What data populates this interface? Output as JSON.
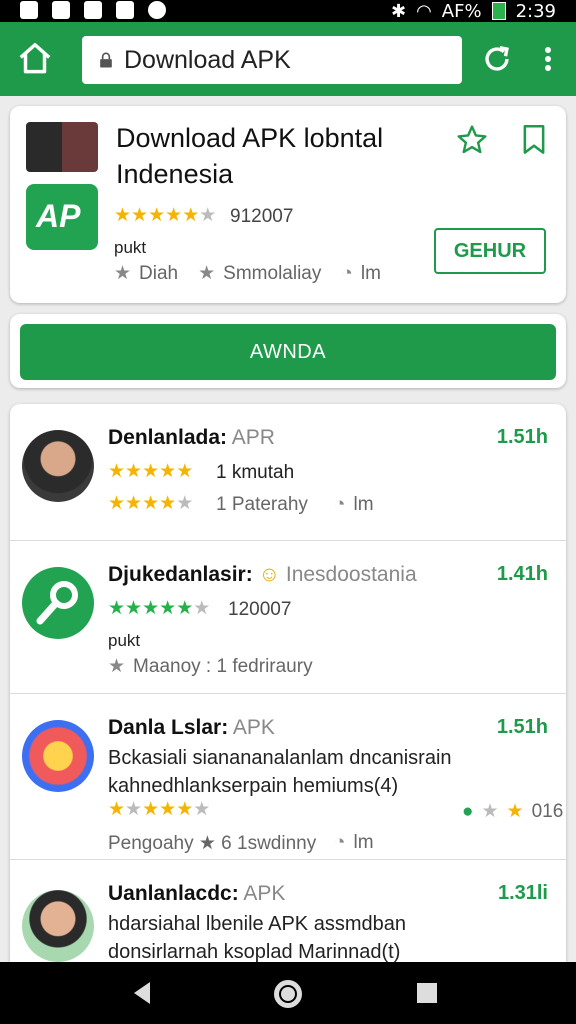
{
  "status": {
    "carrier": "AF%",
    "time": "2:39"
  },
  "browser": {
    "url_title": "Download APK"
  },
  "hero": {
    "title_line1": "Download APK lobntal",
    "title_line2": "Indenesia",
    "rating": 4.5,
    "rating_count": "912007",
    "tag": "pukt",
    "meta1": "Diah",
    "meta2": "Smmolaliay",
    "meta3": "lm",
    "get_label": "GEHUR",
    "logo_text": "AP"
  },
  "download": {
    "label": "AWNDA"
  },
  "list": [
    {
      "title": "Denlanlada:",
      "sub": "APR",
      "size": "1.51h",
      "stars_text": "1 kmutah",
      "meta_text": "1  Paterahy",
      "meta_icon_text": "lm"
    },
    {
      "title": "Djukedanlasir:",
      "sub": "Inesdoostania",
      "size": "1.41h",
      "stars_text": "120007",
      "tag": "pukt",
      "meta_text": "Maanoy :  1 fedriraury"
    },
    {
      "title": "Danla Lslar:",
      "sub": "APK",
      "size": "1.51h",
      "desc1": "Bckasiali sianananalanlam dncanisrain",
      "desc2": "kahnedhlankserpain hemiums(4)",
      "rating_small": "016",
      "meta_text": "Pengoahy ★ 6  1swdinny",
      "meta_icon_text": "lm"
    },
    {
      "title": "Uanlanlacdc:",
      "sub": "APK",
      "size": "1.31li",
      "desc1": "hdarsiahal  lbenile APK assmdban",
      "desc2": "donsirlarnah ksoplad Marinnad(t)"
    }
  ]
}
